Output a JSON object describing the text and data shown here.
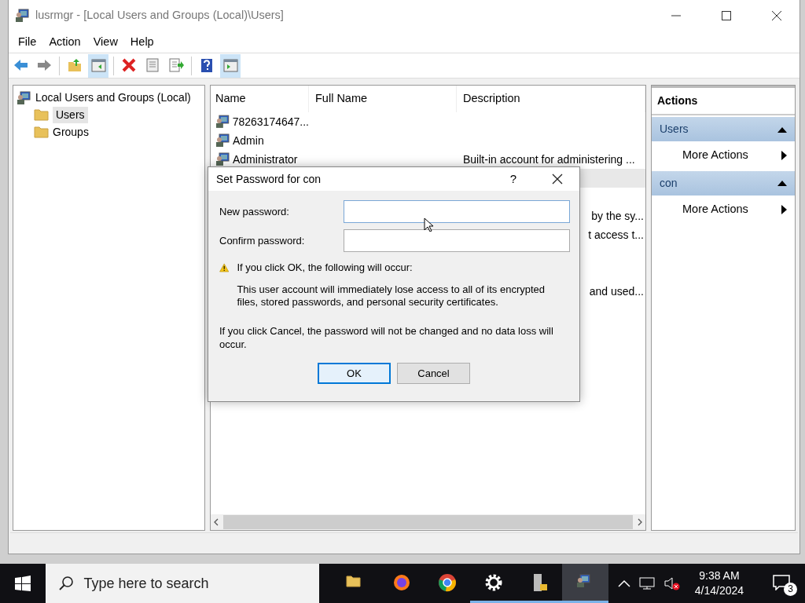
{
  "window": {
    "title": "lusrmgr - [Local Users and Groups (Local)\\Users]"
  },
  "menu": [
    {
      "label": "File"
    },
    {
      "label": "Action"
    },
    {
      "label": "View"
    },
    {
      "label": "Help"
    }
  ],
  "toolbar": [
    [
      {
        "kind": "back",
        "pressed": false
      },
      {
        "kind": "forward",
        "pressed": false
      }
    ],
    [
      {
        "kind": "up",
        "pressed": false
      },
      {
        "kind": "tree",
        "pressed": true
      }
    ],
    [
      {
        "kind": "delete",
        "pressed": false
      },
      {
        "kind": "properties",
        "pressed": false
      },
      {
        "kind": "export",
        "pressed": false
      }
    ],
    [
      {
        "kind": "help",
        "pressed": false
      },
      {
        "kind": "pane",
        "pressed": true
      }
    ]
  ],
  "tree": {
    "label": "Local Users and Groups (Local)",
    "children": [
      {
        "label": "Users",
        "selected": true
      },
      {
        "label": "Groups",
        "selected": false
      }
    ]
  },
  "list": {
    "columns": [
      "Name",
      "Full Name",
      "Description"
    ],
    "rows": [
      {
        "kind": "full",
        "name": "78263174647...",
        "description": "",
        "selected": false
      },
      {
        "kind": "full",
        "name": "Admin",
        "description": "",
        "selected": false
      },
      {
        "kind": "full",
        "name": "Administrator",
        "description": "Built-in account for administering ...",
        "selected": false
      },
      {
        "kind": "partial",
        "description": "",
        "selected": true
      },
      {
        "kind": "partial",
        "description": "",
        "selected": false
      },
      {
        "kind": "partial",
        "description": "by the sy...",
        "selected": false
      },
      {
        "kind": "partial",
        "description": "t access t...",
        "selected": false
      },
      {
        "kind": "partial",
        "description": "",
        "selected": false
      },
      {
        "kind": "partial",
        "description": "",
        "selected": false
      },
      {
        "kind": "partial",
        "description": "and used...",
        "selected": false
      }
    ]
  },
  "actions": {
    "title": "Actions",
    "sections": [
      {
        "label": "Users",
        "items": [
          {
            "label": "More Actions"
          }
        ]
      },
      {
        "label": "con",
        "items": [
          {
            "label": "More Actions"
          }
        ]
      }
    ]
  },
  "dialog": {
    "title": "Set Password for con",
    "help": "?",
    "fields": [
      {
        "label": "New password:",
        "focused": true
      },
      {
        "label": "Confirm password:",
        "focused": false
      }
    ],
    "warning_heading": "If you click OK, the following will occur:",
    "warning_body": "This user account will immediately lose access to all of its encrypted files, stored passwords, and personal security certificates.",
    "cancel_note": "If you click Cancel, the password will not be changed and no data loss will occur.",
    "buttons": [
      {
        "label": "OK",
        "default": true
      },
      {
        "label": "Cancel",
        "default": false
      }
    ]
  },
  "taskbar": {
    "search_placeholder": "Type here to search",
    "apps": [
      {
        "kind": "folder",
        "running": false,
        "active": false
      },
      {
        "kind": "firefox",
        "running": false,
        "active": false
      },
      {
        "kind": "chrome",
        "running": false,
        "active": false
      },
      {
        "kind": "gear",
        "running": true,
        "active": false
      },
      {
        "kind": "server",
        "running": true,
        "active": false
      },
      {
        "kind": "users",
        "running": true,
        "active": true
      }
    ],
    "time": "9:38 AM",
    "date": "4/14/2024",
    "notifications": "3"
  }
}
